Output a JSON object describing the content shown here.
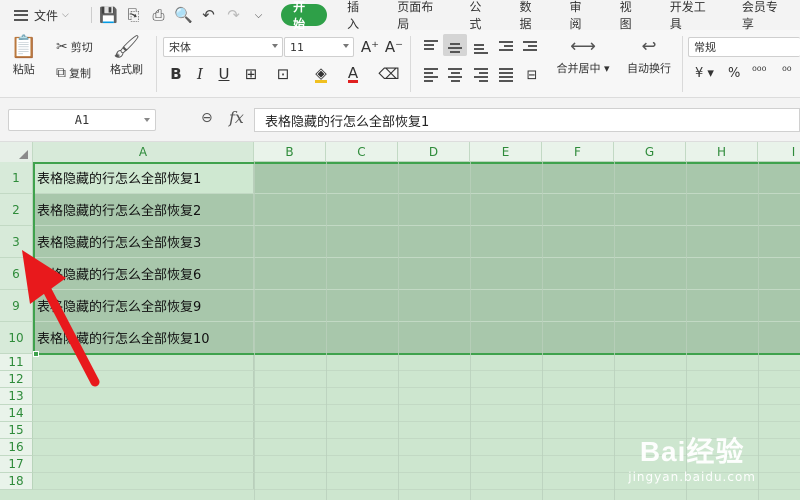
{
  "menubar": {
    "file_label": "文件",
    "tabs": [
      "开始",
      "插入",
      "页面布局",
      "公式",
      "数据",
      "审阅",
      "视图",
      "开发工具",
      "会员专享"
    ]
  },
  "ribbon": {
    "paste": "粘贴",
    "cut": "剪切",
    "copy": "复制",
    "format_painter": "格式刷",
    "font_name": "宋体",
    "font_size": "11",
    "merge_center": "合并居中",
    "wrap_text": "自动换行",
    "number_format": "常规",
    "currency_symbol": "¥",
    "percent_symbol": "%",
    "decimal_inc": "⁰⁰⁰",
    "decimal_dec": "⁰⁰"
  },
  "formula_bar": {
    "name_box": "A1",
    "fx": "fx",
    "content": "表格隐藏的行怎么全部恢复1"
  },
  "grid": {
    "columns": [
      "A",
      "B",
      "C",
      "D",
      "E",
      "F",
      "G",
      "H",
      "I"
    ],
    "rows": [
      {
        "num": "1",
        "value": "表格隐藏的行怎么全部恢复1"
      },
      {
        "num": "2",
        "value": "表格隐藏的行怎么全部恢复2"
      },
      {
        "num": "3",
        "value": "表格隐藏的行怎么全部恢复3"
      },
      {
        "num": "6",
        "value": "表格隐藏的行怎么全部恢复6"
      },
      {
        "num": "9",
        "value": "表格隐藏的行怎么全部恢复9"
      },
      {
        "num": "10",
        "value": "表格隐藏的行怎么全部恢复10"
      },
      {
        "num": "11",
        "value": ""
      },
      {
        "num": "12",
        "value": ""
      },
      {
        "num": "13",
        "value": ""
      },
      {
        "num": "14",
        "value": ""
      },
      {
        "num": "15",
        "value": ""
      },
      {
        "num": "16",
        "value": ""
      },
      {
        "num": "17",
        "value": ""
      },
      {
        "num": "18",
        "value": ""
      }
    ]
  },
  "watermark": {
    "brand": "Bai经验",
    "url": "jingyan.baidu.com"
  },
  "colors": {
    "accent": "#2ea048",
    "selection": "#3fa24d",
    "arrow": "#e8191c"
  }
}
